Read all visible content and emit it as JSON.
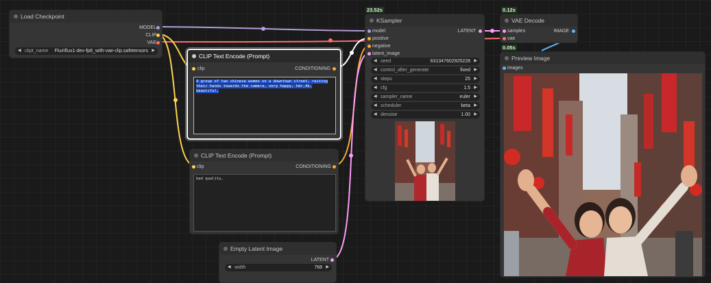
{
  "colors": {
    "model": "#b39ddb",
    "clip": "#ffd54f",
    "vae": "#ff6e6e",
    "conditioning": "#ffa931",
    "latent": "#ff9cf9",
    "image": "#64b5f6"
  },
  "timings": {
    "ksampler": "23.52s",
    "vae_decode": "0.12s",
    "preview": "0.05s"
  },
  "load_checkpoint": {
    "title": "Load Checkpoint",
    "outputs": [
      "MODEL",
      "CLIP",
      "VAE"
    ],
    "ckpt_label": "ckpt_name",
    "ckpt_value": "Flux\\flux1-dev-fp8_with-vae-clip.safetensors"
  },
  "clip_pos": {
    "title": "CLIP Text Encode (Prompt)",
    "input": "clip",
    "output": "CONDITIONING",
    "text": "A group of two chinese women on a downtown street, raising their hands towards the camera, very happy, hdr,4k, beautiful,"
  },
  "clip_neg": {
    "title": "CLIP Text Encode (Prompt)",
    "input": "clip",
    "output": "CONDITIONING",
    "text": "bad quality,"
  },
  "empty_latent": {
    "title": "Empty Latent Image",
    "output": "LATENT",
    "width_label": "width",
    "width_value": "768"
  },
  "ksampler": {
    "title": "KSampler",
    "inputs": [
      "model",
      "positive",
      "negative",
      "latent_image"
    ],
    "output": "LATENT",
    "widgets": [
      {
        "label": "seed",
        "value": "631347602925228"
      },
      {
        "label": "control_after_generate",
        "value": "fixed"
      },
      {
        "label": "steps",
        "value": "25"
      },
      {
        "label": "cfg",
        "value": "1.5"
      },
      {
        "label": "sampler_name",
        "value": "euler"
      },
      {
        "label": "scheduler",
        "value": "beta"
      },
      {
        "label": "denoise",
        "value": "1.00"
      }
    ]
  },
  "vae_decode": {
    "title": "VAE Decode",
    "inputs": [
      "samples",
      "vae"
    ],
    "output": "IMAGE"
  },
  "preview": {
    "title": "Preview Image",
    "input": "images"
  }
}
